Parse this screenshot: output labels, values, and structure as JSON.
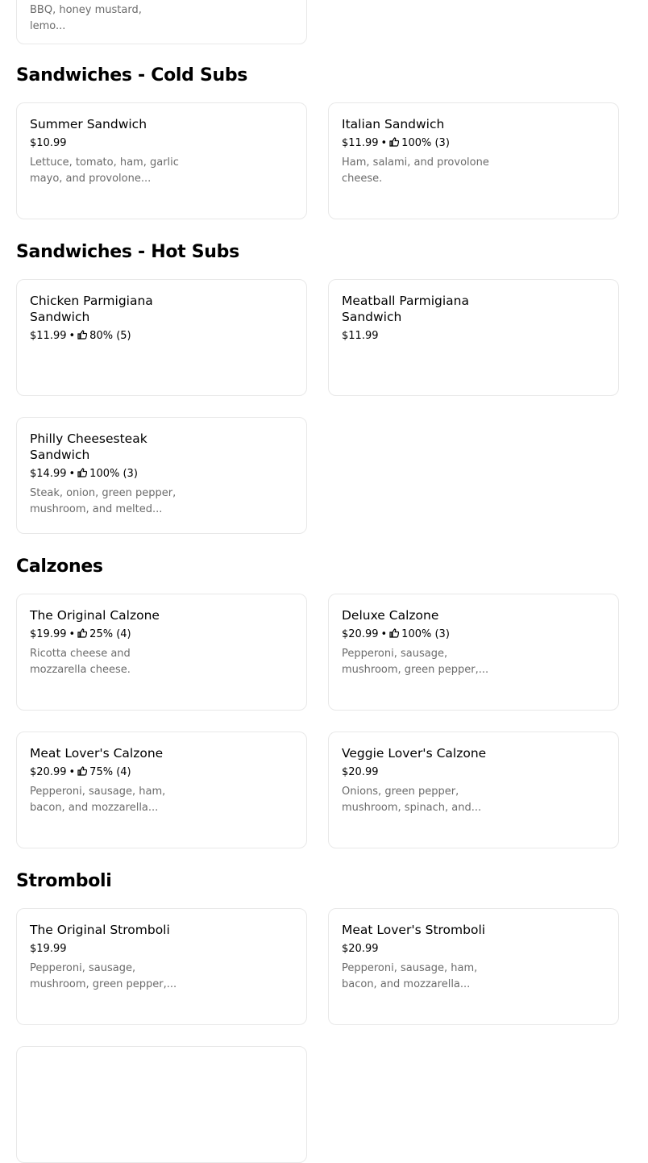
{
  "top_card": {
    "desc_fragment": "BBQ, honey mustard, lemo..."
  },
  "sections": {
    "cold_subs": {
      "title": "Sandwiches - Cold Subs",
      "items": [
        {
          "name": "Summer Sandwich",
          "price": "$10.99",
          "rating": "",
          "desc": "Lettuce, tomato, ham, garlic mayo, and provolone..."
        },
        {
          "name": "Italian Sandwich",
          "price": "$11.99",
          "rating": "100% (3)",
          "desc": "Ham, salami, and provolone cheese."
        }
      ]
    },
    "hot_subs": {
      "title": "Sandwiches - Hot Subs",
      "items": [
        {
          "name": "Chicken Parmigiana Sandwich",
          "price": "$11.99",
          "rating": "80% (5)",
          "desc": ""
        },
        {
          "name": "Meatball Parmigiana Sandwich",
          "price": "$11.99",
          "rating": "",
          "desc": ""
        },
        {
          "name": "Philly Cheesesteak Sandwich",
          "price": "$14.99",
          "rating": "100% (3)",
          "desc": "Steak, onion, green pepper, mushroom, and melted..."
        }
      ]
    },
    "calzones": {
      "title": "Calzones",
      "items": [
        {
          "name": "The Original Calzone",
          "price": "$19.99",
          "rating": "25% (4)",
          "desc": "Ricotta cheese and mozzarella cheese."
        },
        {
          "name": "Deluxe Calzone",
          "price": "$20.99",
          "rating": "100% (3)",
          "desc": "Pepperoni, sausage, mushroom, green pepper,..."
        },
        {
          "name": "Meat Lover's Calzone",
          "price": "$20.99",
          "rating": "75% (4)",
          "desc": "Pepperoni, sausage, ham, bacon, and mozzarella..."
        },
        {
          "name": "Veggie Lover's Calzone",
          "price": "$20.99",
          "rating": "",
          "desc": "Onions, green pepper, mushroom, spinach, and..."
        }
      ]
    },
    "stromboli": {
      "title": "Stromboli",
      "items": [
        {
          "name": "The Original Stromboli",
          "price": "$19.99",
          "rating": "",
          "desc": "Pepperoni, sausage, mushroom, green pepper,..."
        },
        {
          "name": "Meat Lover's Stromboli",
          "price": "$20.99",
          "rating": "",
          "desc": "Pepperoni, sausage, ham, bacon, and mozzarella..."
        }
      ]
    }
  },
  "icons": {
    "rating": "thumbs-up-icon"
  },
  "separator": "•"
}
